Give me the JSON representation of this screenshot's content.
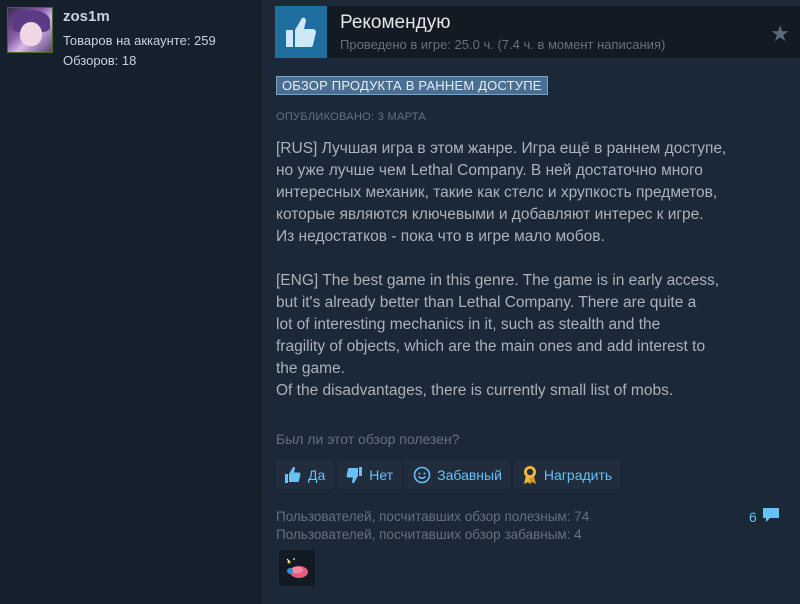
{
  "user": {
    "name": "zos1m",
    "products_label": "Товаров на аккаунте: 259",
    "reviews_label": "Обзоров: 18"
  },
  "review": {
    "verdict": "Рекомендую",
    "playtime": "Проведено в игре: 25.0 ч. (7.4 ч. в момент написания)",
    "badge": "ОБЗОР ПРОДУКТА В РАННЕМ ДОСТУПЕ",
    "posted": "ОПУБЛИКОВАНО: 3 МАРТА",
    "body_ru": "[RUS] Лучшая игра в этом жанре. Игра ещё в раннем доступе,\nно уже лучше чем Lethal Company. В ней достаточно много\nинтересных механик, такие как стелс и хрупкость предметов,\nкоторые являются ключевыми и добавляют интерес к игре.\nИз недостатков - пока что в игре мало мобов.",
    "body_en": "[ENG] The best game in this genre. The game is in early access,\nbut it's already better than Lethal Company. There are quite a\nlot of interesting mechanics in it, such as stealth and the\nfragility of objects, which are the main ones and add interest to\nthe game.\nOf the disadvantages, there is currently small list of mobs."
  },
  "feedback": {
    "question": "Был ли этот обзор полезен?",
    "yes": "Да",
    "no": "Нет",
    "funny": "Забавный",
    "award": "Наградить"
  },
  "stats": {
    "helpful": "Пользователей, посчитавших обзор полезным: 74",
    "funny": "Пользователей, посчитавших обзор забавным: 4",
    "comments": "6"
  },
  "icons": {
    "thumb": "thumbs-up-icon",
    "star": "star-icon",
    "comment": "comment-bubble-icon"
  },
  "colors": {
    "background": "#1b2838",
    "link": "#67c1f5",
    "badge": "#4a6f93"
  }
}
